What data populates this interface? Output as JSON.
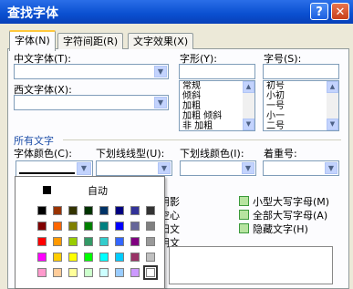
{
  "window": {
    "title": "查找字体",
    "help_icon": "?",
    "close_icon": "✕"
  },
  "tabs": [
    "字体(N)",
    "字符间距(R)",
    "文字效果(X)"
  ],
  "font": {
    "chinese_label": "中文字体(T):",
    "western_label": "西文字体(X):",
    "style_label": "字形(Y):",
    "style_items": [
      "常规",
      "倾斜",
      "加粗",
      "加粗 倾斜",
      "非 加粗"
    ],
    "size_label": "字号(S):",
    "size_items": [
      "初号",
      "小初",
      "一号",
      "小一",
      "二号"
    ]
  },
  "all_text": {
    "section_label": "所有文字",
    "font_color_label": "字体颜色(C):",
    "underline_type_label": "下划线线型(U):",
    "underline_color_label": "下划线颜色(I):",
    "emphasis_label": "着重号:"
  },
  "effects": {
    "partial": [
      "阴影",
      "空心",
      "阳文",
      "阴文"
    ],
    "checkboxes": [
      "小型大写字母(M)",
      "全部大写字母(A)",
      "隐藏文字(H)"
    ]
  },
  "color_popup": {
    "auto_label": "自动",
    "rows": [
      [
        "#000000",
        "#993300",
        "#333300",
        "#003300",
        "#003366",
        "#000080",
        "#333399",
        "#333333"
      ],
      [
        "#800000",
        "#FF6600",
        "#808000",
        "#008000",
        "#008080",
        "#0000FF",
        "#666699",
        "#808080"
      ],
      [
        "#FF0000",
        "#FF9900",
        "#99CC00",
        "#339966",
        "#33CCCC",
        "#3366FF",
        "#800080",
        "#999999"
      ],
      [
        "#FF00FF",
        "#FFCC00",
        "#FFFF00",
        "#00FF00",
        "#00FFFF",
        "#00CCFF",
        "#993366",
        "#C0C0C0"
      ],
      [
        "#FF99CC",
        "#FFCC99",
        "#FFFF99",
        "#CCFFCC",
        "#CCFFFF",
        "#99CCFF",
        "#CC99FF",
        "#FFFFFF"
      ]
    ]
  }
}
